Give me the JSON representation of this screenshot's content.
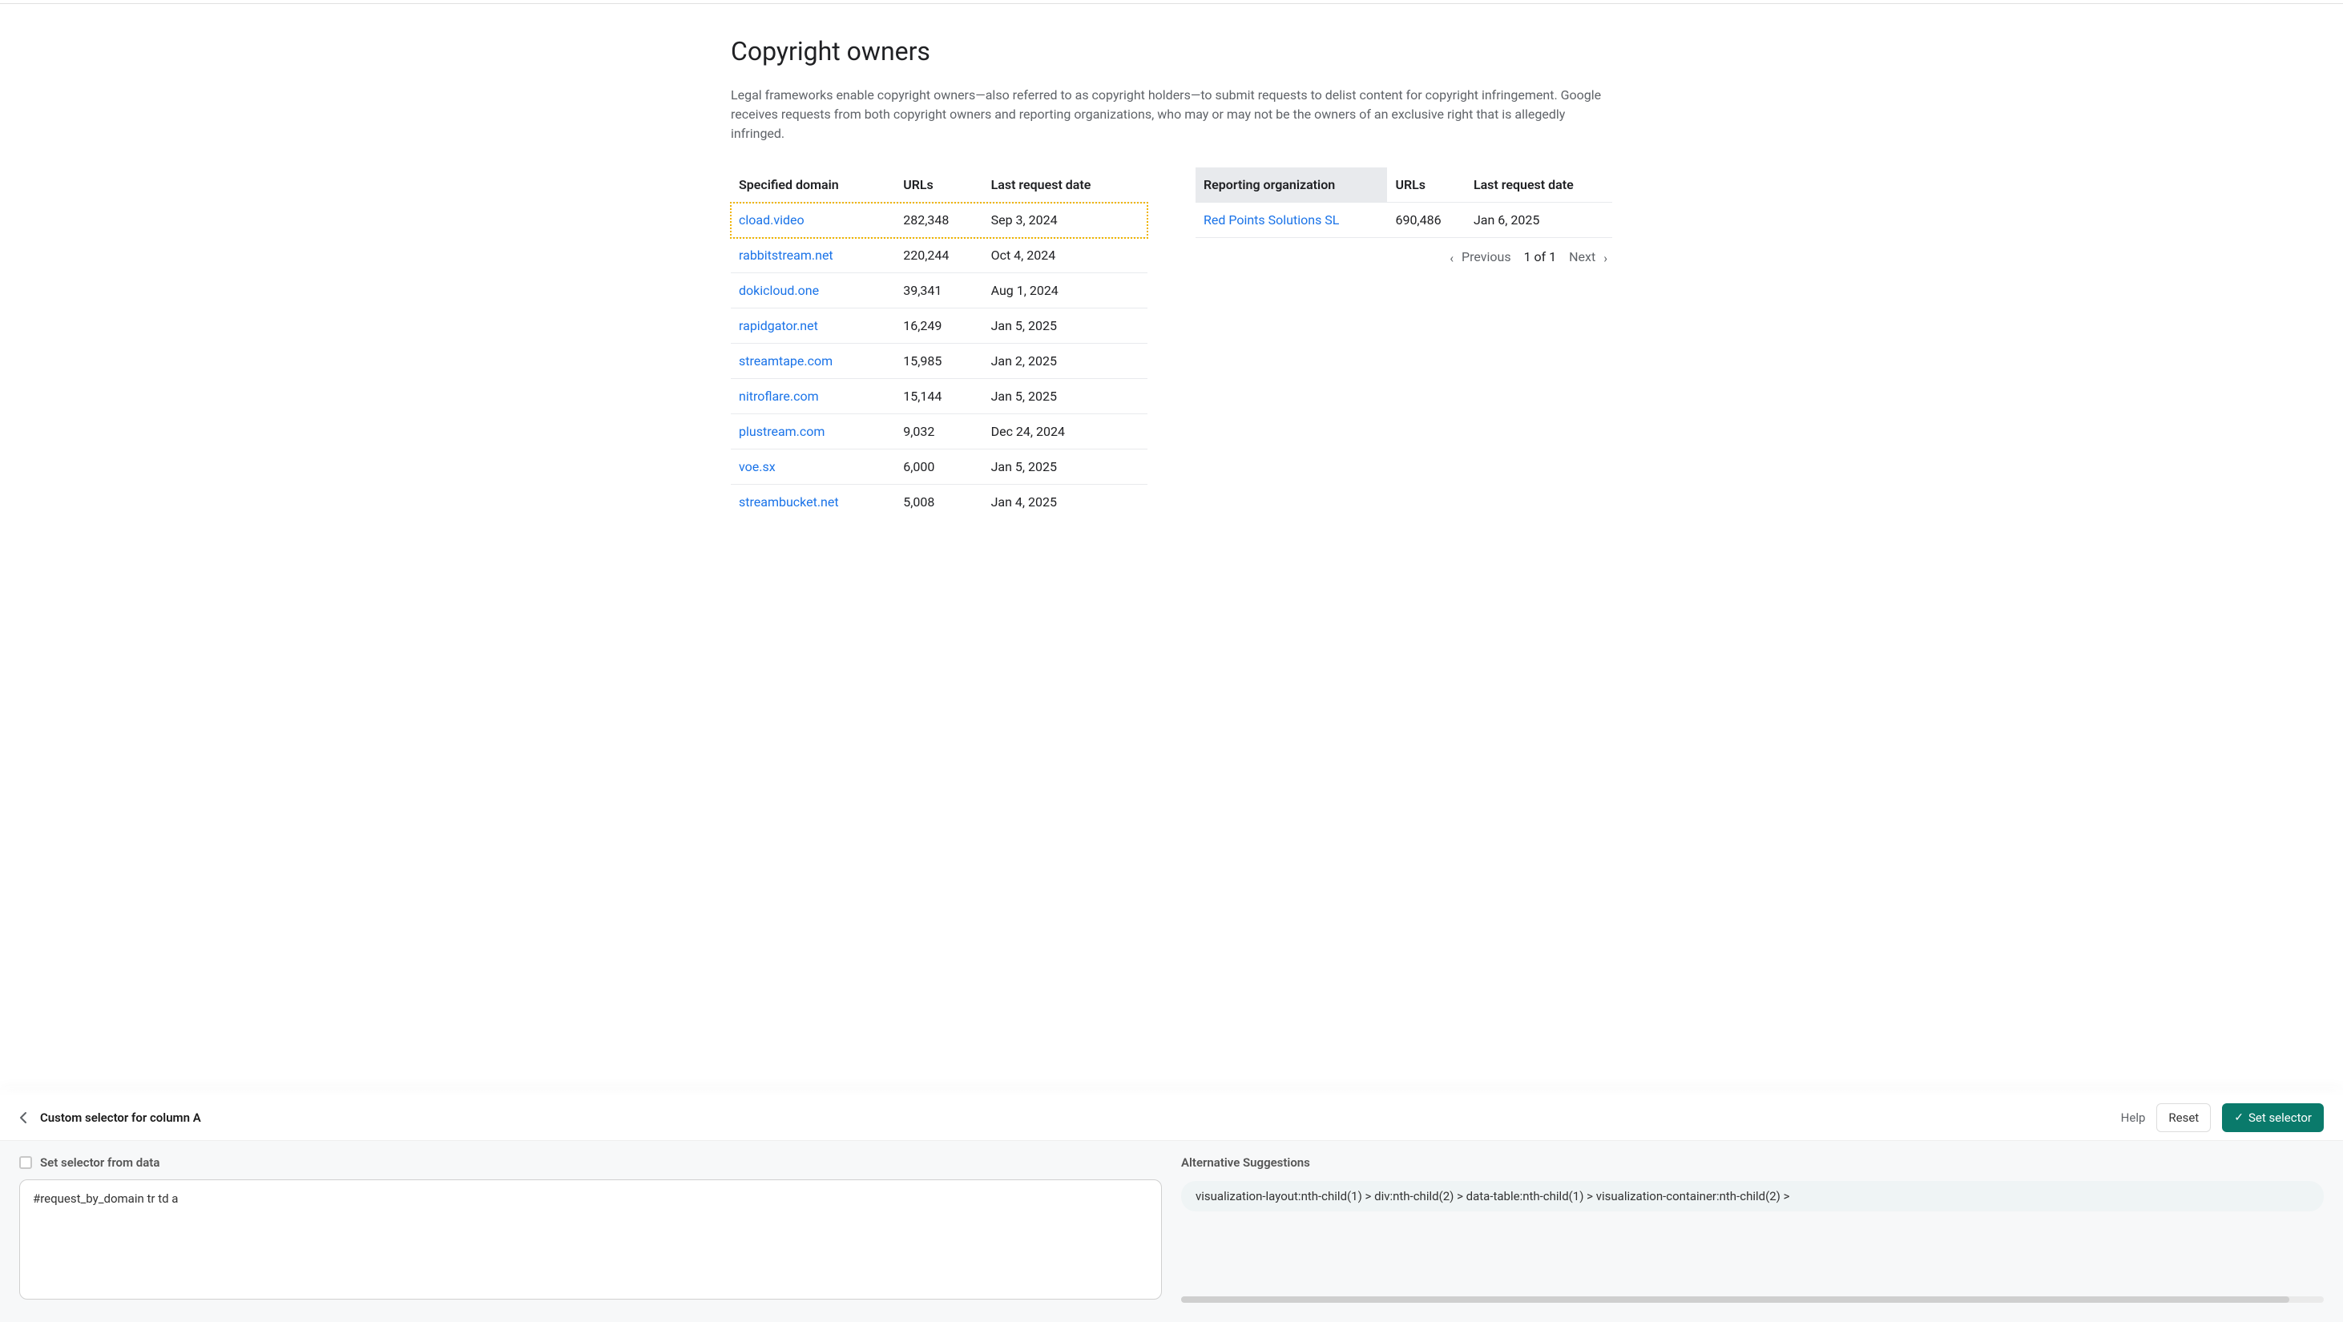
{
  "page": {
    "title": "Copyright owners",
    "description": "Legal frameworks enable copyright owners—also referred to as copyright holders—to submit requests to delist content for copyright infringement. Google receives requests from both copyright owners and reporting organizations, who may or may not be the owners of an exclusive right that is allegedly infringed."
  },
  "domainTable": {
    "headers": {
      "domain": "Specified domain",
      "urls": "URLs",
      "date": "Last request date"
    },
    "rows": [
      {
        "domain": "cload.video",
        "urls": "282,348",
        "date": "Sep 3, 2024"
      },
      {
        "domain": "rabbitstream.net",
        "urls": "220,244",
        "date": "Oct 4, 2024"
      },
      {
        "domain": "dokicloud.one",
        "urls": "39,341",
        "date": "Aug 1, 2024"
      },
      {
        "domain": "rapidgator.net",
        "urls": "16,249",
        "date": "Jan 5, 2025"
      },
      {
        "domain": "streamtape.com",
        "urls": "15,985",
        "date": "Jan 2, 2025"
      },
      {
        "domain": "nitroflare.com",
        "urls": "15,144",
        "date": "Jan 5, 2025"
      },
      {
        "domain": "plustream.com",
        "urls": "9,032",
        "date": "Dec 24, 2024"
      },
      {
        "domain": "voe.sx",
        "urls": "6,000",
        "date": "Jan 5, 2025"
      },
      {
        "domain": "streambucket.net",
        "urls": "5,008",
        "date": "Jan 4, 2025"
      }
    ]
  },
  "orgTable": {
    "headers": {
      "org": "Reporting organization",
      "urls": "URLs",
      "date": "Last request date"
    },
    "rows": [
      {
        "org": "Red Points Solutions SL",
        "urls": "690,486",
        "date": "Jan 6, 2025"
      }
    ],
    "pagination": {
      "previous": "Previous",
      "next": "Next",
      "info": "1 of 1"
    }
  },
  "panel": {
    "title": "Custom selector for column A",
    "help": "Help",
    "reset": "Reset",
    "setSelector": "Set selector",
    "checkboxLabel": "Set selector from data",
    "selectorValue": "#request_by_domain tr td a",
    "altTitle": "Alternative Suggestions",
    "suggestion": "visualization-layout:nth-child(1) > div:nth-child(2) > data-table:nth-child(1) > visualization-container:nth-child(2) >"
  }
}
